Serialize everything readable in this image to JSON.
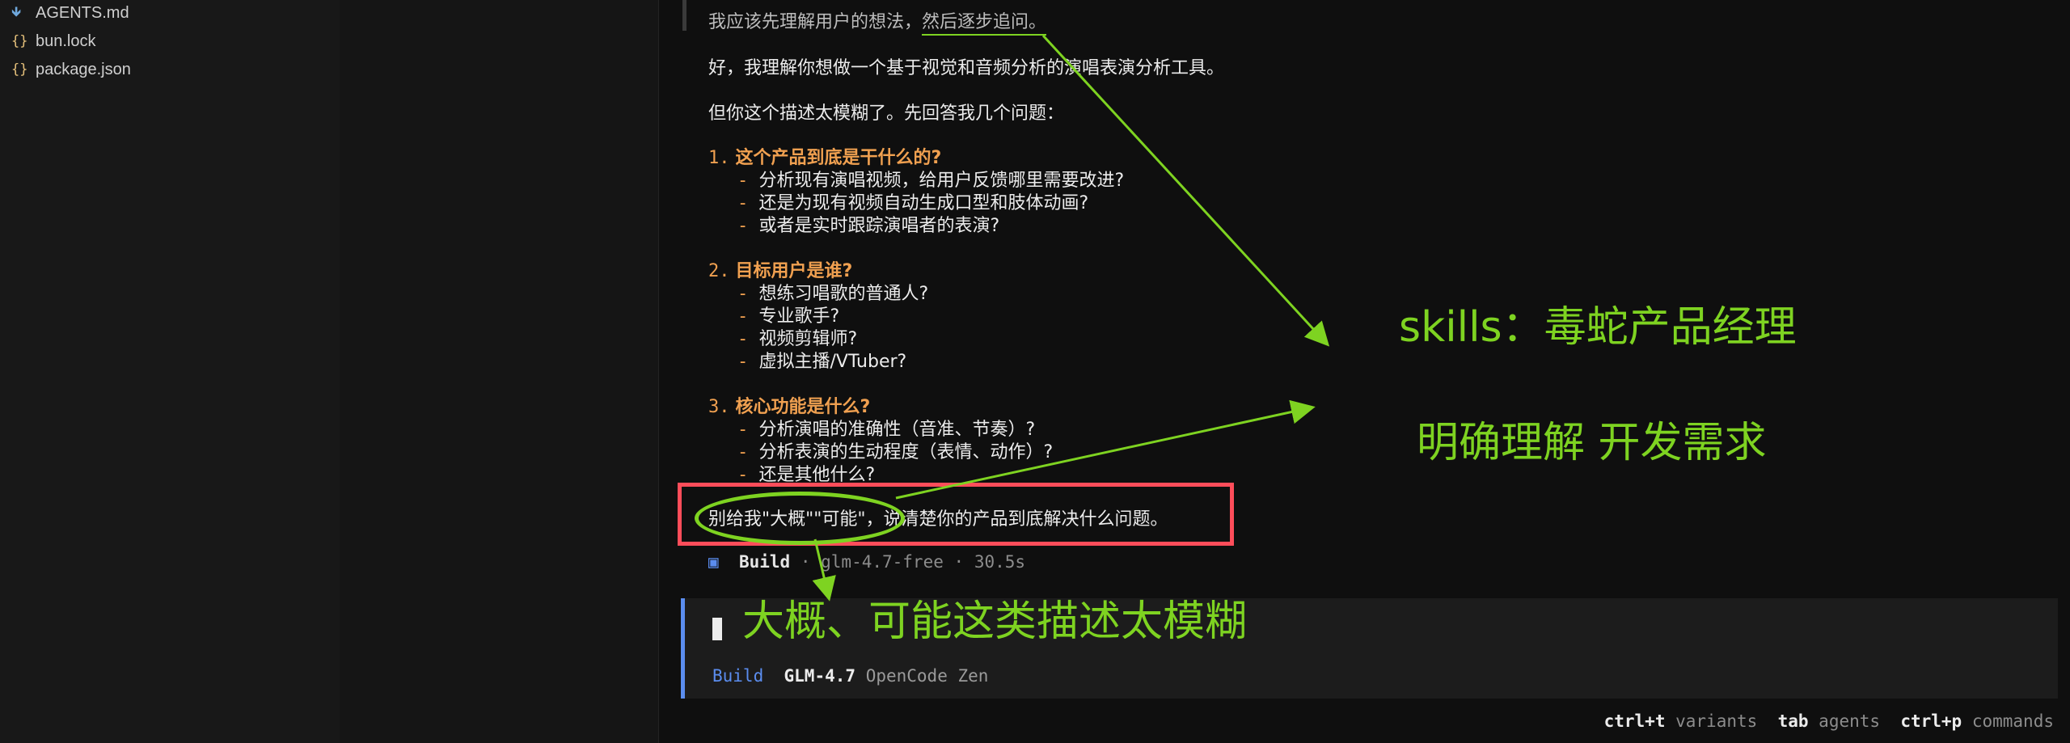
{
  "files": [
    {
      "icon": "🡻",
      "name": "AGENTS.md"
    },
    {
      "icon": "{}",
      "name": "bun.lock"
    },
    {
      "icon": "{}",
      "name": "package.json"
    }
  ],
  "chat": {
    "quote": "我应该先理解用户的想法，",
    "quote_underlined": "然后逐步追问。",
    "p1": "好，我理解你想做一个基于视觉和音频分析的演唱表演分析工具。",
    "p2": "但你这个描述太模糊了。先回答我几个问题：",
    "q1": {
      "num": "1.",
      "title": "这个产品到底是干什么的?",
      "items": [
        "分析现有演唱视频，给用户反馈哪里需要改进?",
        "还是为现有视频自动生成口型和肢体动画?",
        "或者是实时跟踪演唱者的表演?"
      ]
    },
    "q2": {
      "num": "2.",
      "title": "目标用户是谁?",
      "items": [
        "想练习唱歌的普通人?",
        "专业歌手?",
        "视频剪辑师?",
        "虚拟主播/VTuber?"
      ]
    },
    "q3": {
      "num": "3.",
      "title": "核心功能是什么?",
      "items": [
        "分析演唱的准确性（音准、节奏）?",
        "分析表演的生动程度（表情、动作）?",
        "还是其他什么?"
      ]
    },
    "closing": "别给我\"大概\"\"可能\"，说清楚你的产品到底解决什么问题。"
  },
  "build": {
    "icon": "▣",
    "label": "Build",
    "sep": "·",
    "model": "glm-4.7-free",
    "time": "30.5s"
  },
  "input": {
    "mode": "Build",
    "model": "GLM-4.7",
    "provider": "OpenCode Zen"
  },
  "footer": [
    {
      "key": "ctrl+t",
      "label": "variants"
    },
    {
      "key": "tab",
      "label": "agents"
    },
    {
      "key": "ctrl+p",
      "label": "commands"
    }
  ],
  "annotations": {
    "skills": "skills：毒蛇产品经理",
    "clarify": "明确理解 开发需求",
    "vague": "大概、可能这类描述太模糊"
  },
  "colors": {
    "annotation": "#7ed321",
    "highlight_box": "#ff4d5a",
    "accent": "#5b8def",
    "heading": "#f0a050"
  }
}
